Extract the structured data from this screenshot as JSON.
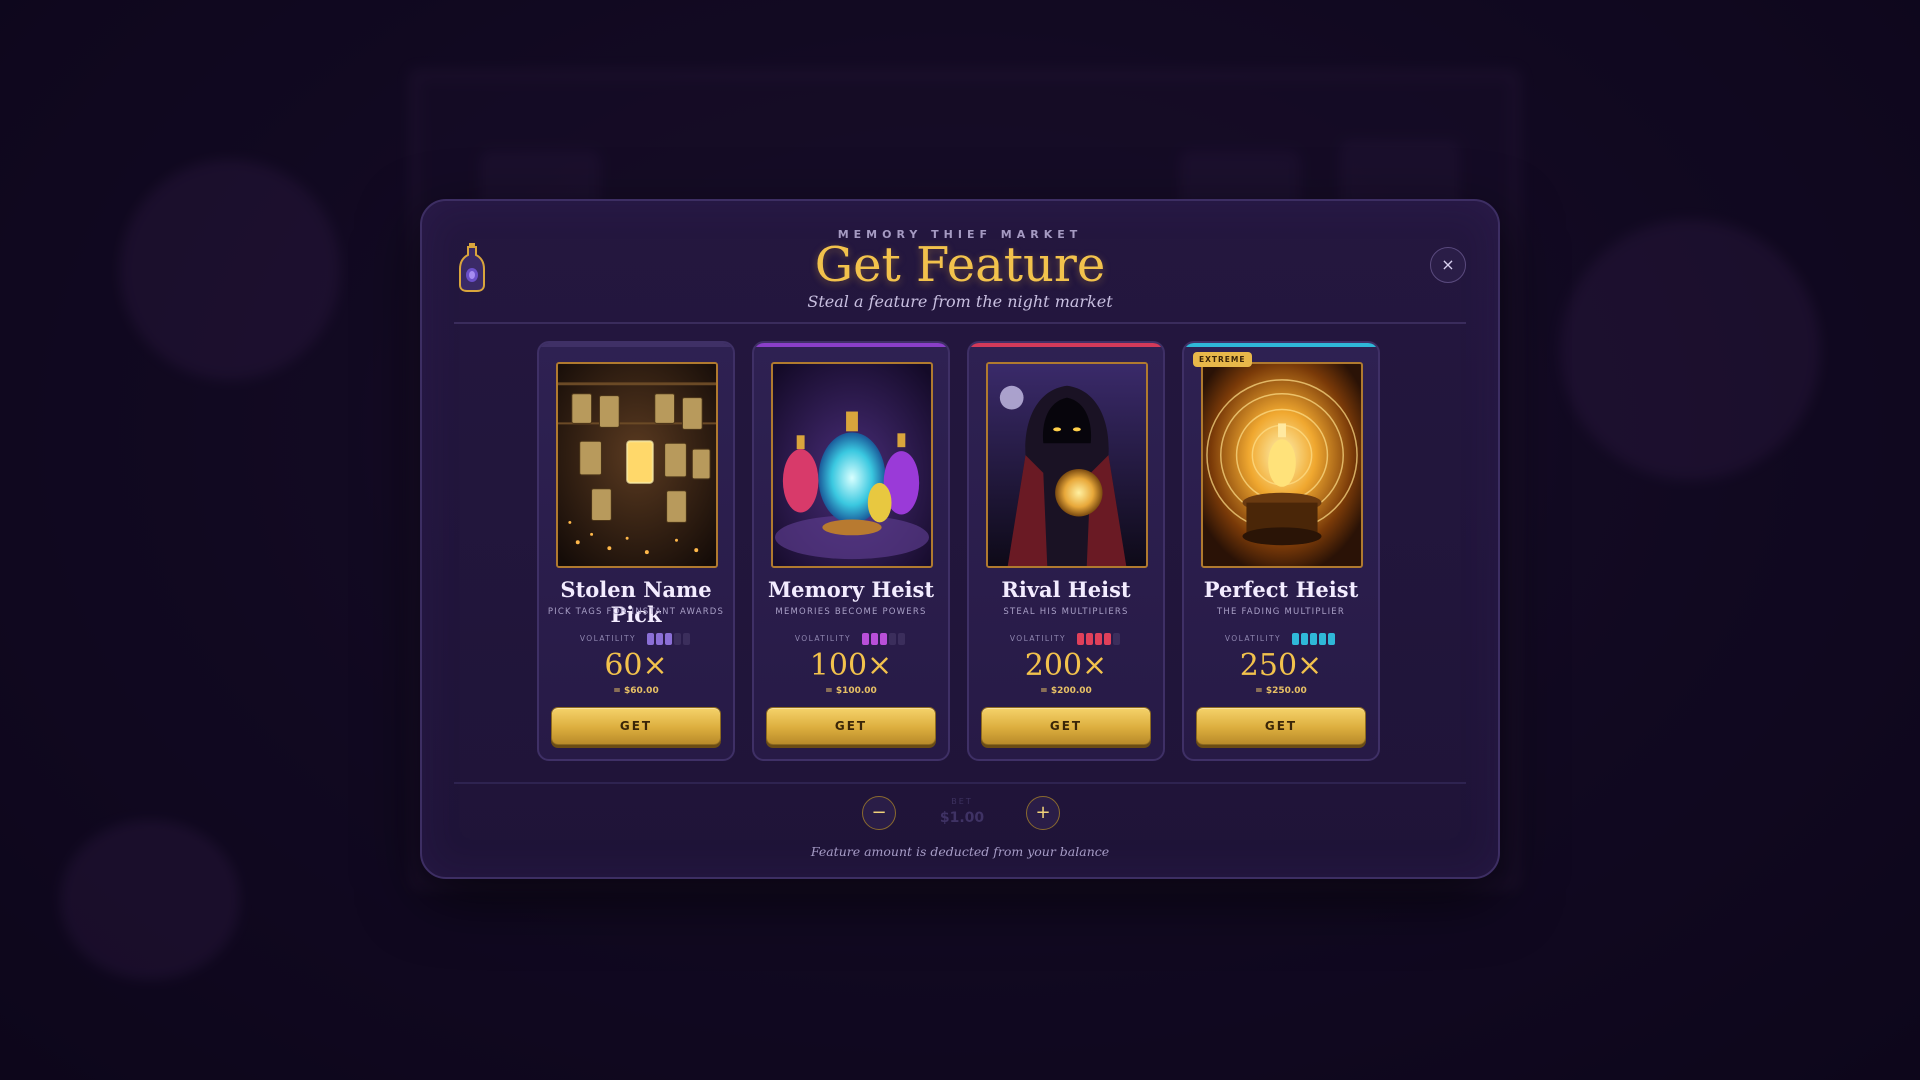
{
  "header": {
    "eyebrow": "MEMORY THIEF MARKET",
    "title": "Get Feature",
    "subtitle": "Steal a feature from the night market",
    "close_label": "×"
  },
  "volatility_label": "VOLATILITY",
  "cards": [
    {
      "name": "Stolen Name Pick",
      "tagline": "PICK TAGS FOR INSTANT AWARDS",
      "volatility_level": 3,
      "volatility_max": 5,
      "volatility_color": "#8b6fd6",
      "multiplier": "60×",
      "price": "= $60.00",
      "button": "GET",
      "accent": "#3f3066",
      "art": "hanging-tags-art"
    },
    {
      "name": "Memory Heist",
      "tagline": "MEMORIES BECOME POWERS",
      "volatility_level": 3,
      "volatility_max": 5,
      "volatility_color": "#b84fd8",
      "multiplier": "100×",
      "price": "= $100.00",
      "button": "GET",
      "accent": "#8a3fc8",
      "art": "potion-bottles-art"
    },
    {
      "name": "Rival Heist",
      "tagline": "STEAL HIS MULTIPLIERS",
      "volatility_level": 4,
      "volatility_max": 5,
      "volatility_color": "#e0405a",
      "multiplier": "200×",
      "price": "= $200.00",
      "button": "GET",
      "accent": "#d23a5a",
      "art": "hooded-thief-art"
    },
    {
      "name": "Perfect Heist",
      "tagline": "THE FADING MULTIPLIER",
      "volatility_level": 5,
      "volatility_max": 5,
      "volatility_color": "#2fb8d8",
      "multiplier": "250×",
      "price": "= $250.00",
      "button": "GET",
      "accent": "#2fb8d8",
      "badge": "EXTREME",
      "art": "glowing-vial-art"
    }
  ],
  "bet": {
    "label": "BET",
    "value": "$1.00",
    "minus": "−",
    "plus": "+"
  },
  "footnote": "Feature amount is deducted from your balance",
  "colors": {
    "gold": "#f2c24c",
    "panel": "#24173f",
    "button": "#e0b043"
  }
}
